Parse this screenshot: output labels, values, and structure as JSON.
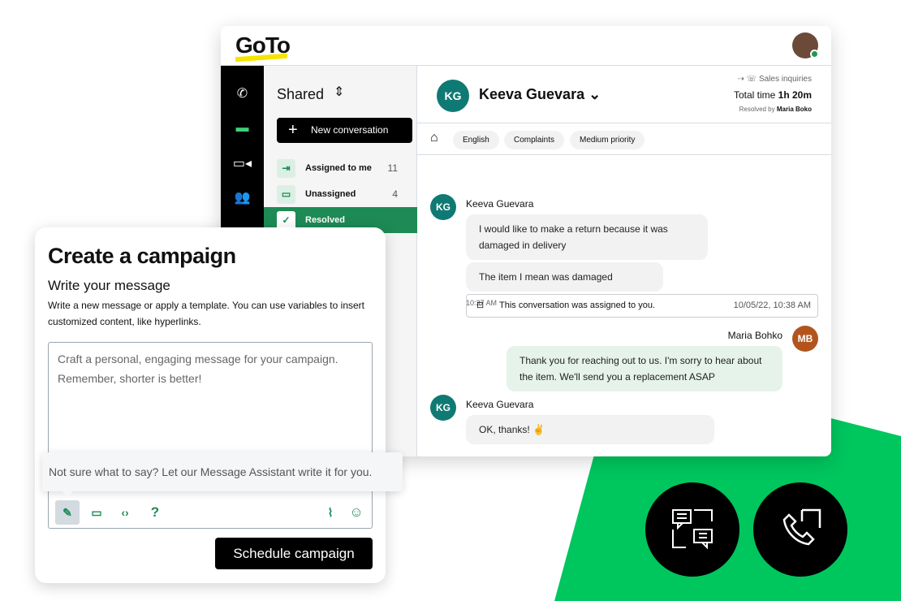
{
  "colors": {
    "brand_green": "#1e8a55",
    "background_green": "#00c65e",
    "logo_yellow": "#f5e400"
  },
  "app": {
    "logo": "GoTo"
  },
  "rail": {
    "icons": [
      "phone-icon",
      "inbox-icon",
      "video-icon",
      "contacts-icon"
    ]
  },
  "sidebar": {
    "title": "Shared",
    "new_conversation": "New conversation",
    "items": [
      {
        "label": "Assigned to me",
        "count": "11"
      },
      {
        "label": "Unassigned",
        "count": "4"
      },
      {
        "label": "Resolved",
        "count": ""
      }
    ]
  },
  "conversation": {
    "contact_initials": "KG",
    "contact_name": "Keeva Guevara",
    "queue": "Sales inquiries",
    "total_time_label": "Total time",
    "total_time": "1h 20m",
    "resolved_by_label": "Resolved by",
    "resolved_by": "Maria Boko",
    "tags": [
      "English",
      "Complaints",
      "Medium priority"
    ],
    "messages": [
      {
        "sender": "Keeva Guevara",
        "initials": "KG",
        "texts": [
          "I would like to make a return because it was damaged in delivery",
          "The item I mean was damaged"
        ],
        "time": "10:37 AM"
      },
      {
        "system": "This conversation was assigned to you.",
        "time": "10/05/22, 10:38 AM"
      },
      {
        "sender": "Maria Bohko",
        "initials": "MB",
        "texts": [
          "Thank you for reaching out to us. I'm sorry to hear about the item. We'll send you a replacement ASAP"
        ]
      },
      {
        "sender": "Keeva Guevara",
        "initials": "KG",
        "texts": [
          "OK, thanks! ✌️"
        ]
      }
    ]
  },
  "campaign": {
    "title": "Create a campaign",
    "subtitle": "Write your message",
    "description": "Write a new message or apply a template. You can use variables to insert customized content, like hyperlinks.",
    "placeholder": "Craft a personal, engaging message for your campaign. Remember, shorter is better!",
    "tooltip": "Not sure what to say? Let our Message Assistant write it for you.",
    "schedule_button": "Schedule campaign"
  }
}
